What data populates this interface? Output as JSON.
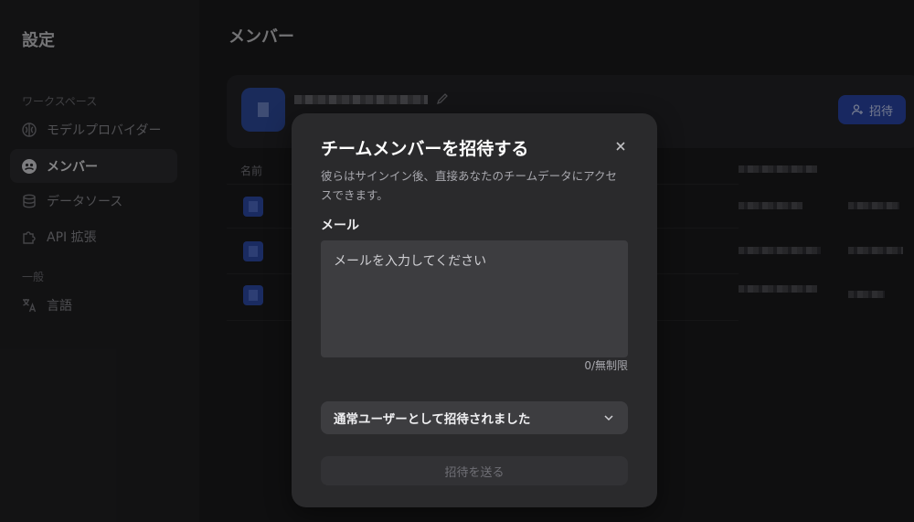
{
  "sidebar": {
    "title": "設定",
    "section_workspace": "ワークスペース",
    "section_general": "一般",
    "items": [
      {
        "label": "モデルプロバイダー",
        "icon": "brain-icon"
      },
      {
        "label": "メンバー",
        "icon": "members-icon",
        "active": true
      },
      {
        "label": "データソース",
        "icon": "database-icon"
      },
      {
        "label": "API 拡張",
        "icon": "puzzle-icon"
      },
      {
        "label": "言語",
        "icon": "translate-icon"
      }
    ]
  },
  "main": {
    "title": "メンバー",
    "invite_button": "招待",
    "column_name": "名前"
  },
  "modal": {
    "title": "チームメンバーを招待する",
    "description": "彼らはサインイン後、直接あなたのチームデータにアクセスできます。",
    "email_label": "メール",
    "email_placeholder": "メールを入力してください",
    "email_value": "",
    "counter": "0/無制限",
    "role_selected": "通常ユーザーとして招待されました",
    "send_button": "招待を送る"
  },
  "colors": {
    "accent": "#2a46a8",
    "modal_bg": "#2a2a2c",
    "input_bg": "#3d3d40"
  }
}
